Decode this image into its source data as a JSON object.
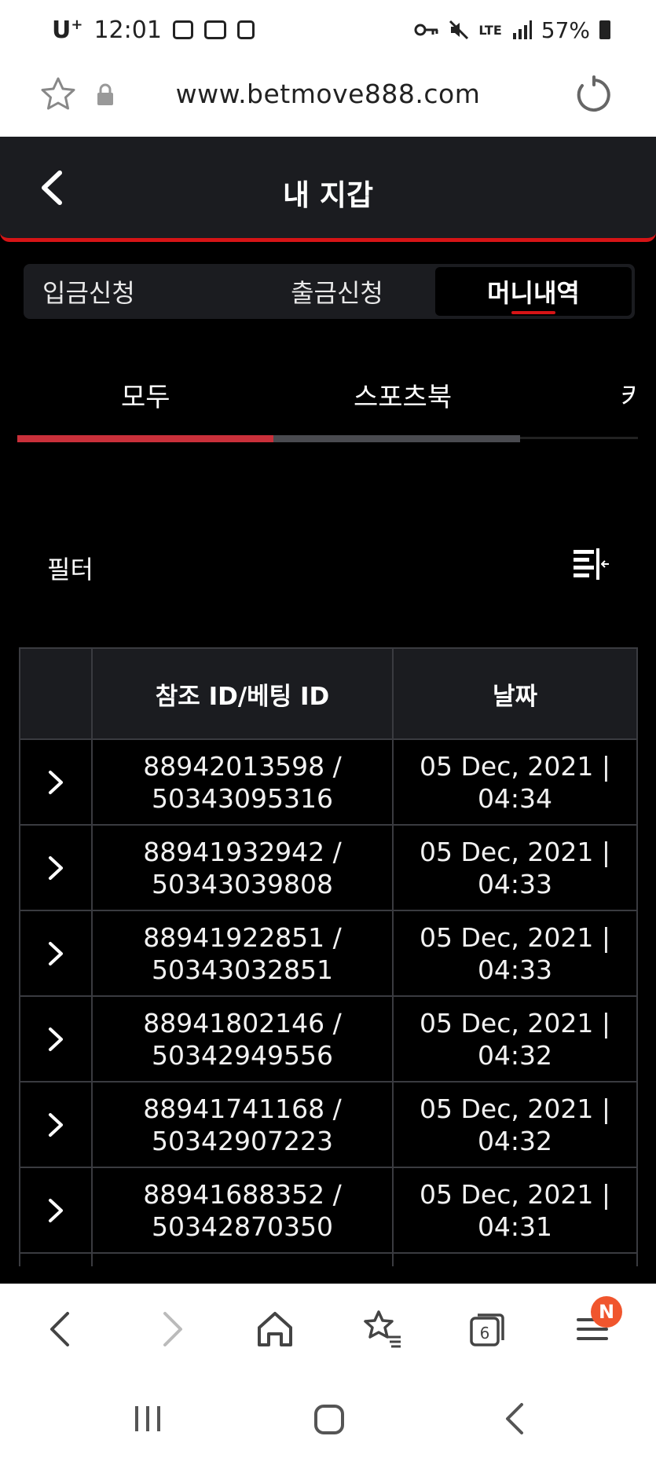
{
  "status_bar": {
    "carrier": "U",
    "carrier_sup": "+",
    "time": "12:01",
    "network": "LTE",
    "battery": "57%"
  },
  "address_bar": {
    "url": "www.betmove888.com"
  },
  "header": {
    "title": "내 지갑"
  },
  "wallet_tabs": [
    {
      "label": "입금신청",
      "active": false
    },
    {
      "label": "출금신청",
      "active": false
    },
    {
      "label": "머니내역",
      "active": true
    }
  ],
  "sub_tabs": [
    {
      "label": "모두",
      "active": true
    },
    {
      "label": "스포츠북",
      "active": false
    },
    {
      "label": "키",
      "active": false
    }
  ],
  "filter": {
    "label": "필터"
  },
  "table": {
    "headers": [
      "",
      "참조 ID/베팅 ID",
      "날짜"
    ],
    "rows": [
      {
        "ref_id": "88942013598 /",
        "bet_id": "50343095316",
        "date": "05 Dec, 2021 |",
        "time": "04:34"
      },
      {
        "ref_id": "88941932942 /",
        "bet_id": "50343039808",
        "date": "05 Dec, 2021 |",
        "time": "04:33"
      },
      {
        "ref_id": "88941922851 /",
        "bet_id": "50343032851",
        "date": "05 Dec, 2021 |",
        "time": "04:33"
      },
      {
        "ref_id": "88941802146 /",
        "bet_id": "50342949556",
        "date": "05 Dec, 2021 |",
        "time": "04:32"
      },
      {
        "ref_id": "88941741168 /",
        "bet_id": "50342907223",
        "date": "05 Dec, 2021 |",
        "time": "04:32"
      },
      {
        "ref_id": "88941688352 /",
        "bet_id": "50342870350",
        "date": "05 Dec, 2021 |",
        "time": "04:31"
      }
    ]
  },
  "bottom_nav": {
    "tab_count": "6",
    "menu_badge": "N",
    "badge_color": "#f0552d"
  },
  "colors": {
    "accent": "#d61416",
    "header_bg": "#1b1c20",
    "background": "#000000"
  }
}
